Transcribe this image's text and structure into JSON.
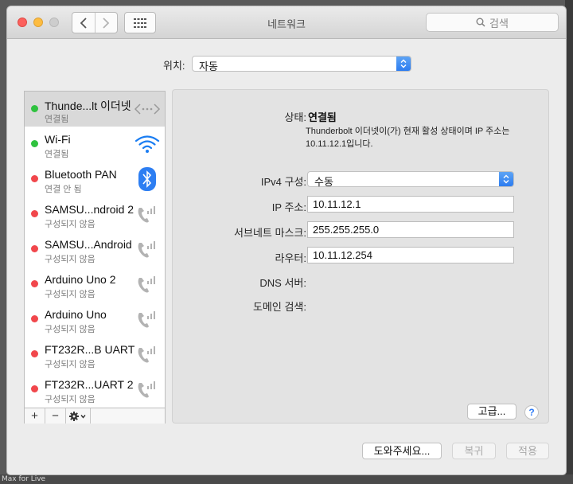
{
  "window": {
    "title": "네트워크",
    "search_placeholder": "검색"
  },
  "background": {
    "bottom_label": "Max for Live"
  },
  "location": {
    "label": "위치:",
    "value": "자동"
  },
  "services": [
    {
      "name": "Thunde...lt 이더넷",
      "status": "연결됨",
      "dot_color": "#2fc23f",
      "icon": "ethernet-icon",
      "selected": true
    },
    {
      "name": "Wi-Fi",
      "status": "연결됨",
      "dot_color": "#2fc23f",
      "icon": "wifi-icon",
      "selected": false
    },
    {
      "name": "Bluetooth PAN",
      "status": "연결 안 됨",
      "dot_color": "#f1474c",
      "icon": "bluetooth-icon",
      "selected": false
    },
    {
      "name": "SAMSU...ndroid 2",
      "status": "구성되지 않음",
      "dot_color": "#f1474c",
      "icon": "phone-icon",
      "selected": false
    },
    {
      "name": "SAMSU...Android",
      "status": "구성되지 않음",
      "dot_color": "#f1474c",
      "icon": "phone-icon",
      "selected": false
    },
    {
      "name": "Arduino Uno 2",
      "status": "구성되지 않음",
      "dot_color": "#f1474c",
      "icon": "phone-icon",
      "selected": false
    },
    {
      "name": "Arduino Uno",
      "status": "구성되지 않음",
      "dot_color": "#f1474c",
      "icon": "phone-icon",
      "selected": false
    },
    {
      "name": "FT232R...B UART",
      "status": "구성되지 않음",
      "dot_color": "#f1474c",
      "icon": "phone-icon",
      "selected": false
    },
    {
      "name": "FT232R...UART 2",
      "status": "구성되지 않음",
      "dot_color": "#f1474c",
      "icon": "phone-icon",
      "selected": false
    }
  ],
  "toolbar": {
    "add": "+",
    "remove": "−"
  },
  "details": {
    "status_label": "상태:",
    "status_value": "연결됨",
    "status_desc": "Thunderbolt 이더넷이(가) 현재 활성 상태이며 IP 주소는 10.11.12.1입니다.",
    "ipv4_label": "IPv4 구성:",
    "ipv4_value": "수동",
    "ip_label": "IP 주소:",
    "ip_value": "10.11.12.1",
    "subnet_label": "서브네트 마스크:",
    "subnet_value": "255.255.255.0",
    "router_label": "라우터:",
    "router_value": "10.11.12.254",
    "dns_label": "DNS 서버:",
    "domain_label": "도메인 검색:",
    "advanced_label": "고급...",
    "help_label": "?"
  },
  "buttons": {
    "assist": "도와주세요...",
    "revert": "복귀",
    "apply": "적용"
  }
}
